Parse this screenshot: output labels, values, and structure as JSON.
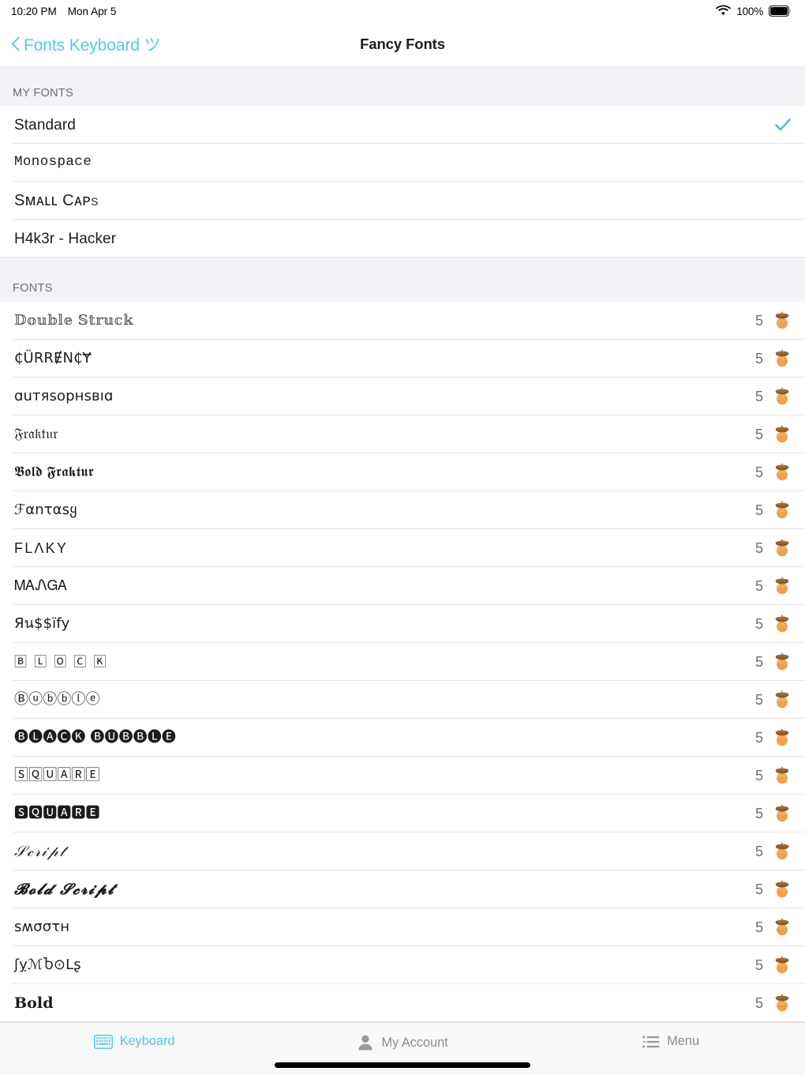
{
  "status_bar": {
    "time": "10:20 PM",
    "date": "Mon Apr 5",
    "battery_percent": "100%",
    "wifi_icon": "wifi-icon",
    "battery_icon": "battery-full-icon"
  },
  "nav": {
    "back_label": "Fonts Keyboard ツ",
    "back_icon": "chevron-left-icon",
    "title": "Fancy Fonts"
  },
  "colors": {
    "accent": "#52c7f2",
    "section_bg": "#f2f2f7",
    "row_bg": "#ffffff",
    "separator": "#e6e6e9",
    "secondary_text": "#6d6d72",
    "primary_text": "#1c1c1e"
  },
  "sections": [
    {
      "header": "MY FONTS",
      "rows": [
        {
          "label": "Standard",
          "style": "plain",
          "selected": true,
          "count": null,
          "locked": false
        },
        {
          "label": "Monospace",
          "style": "mono",
          "selected": false,
          "count": null,
          "locked": false
        },
        {
          "label": "Sᴍᴀʟʟ Cᴀᴘs",
          "style": "smallcaps",
          "selected": false,
          "count": null,
          "locked": false
        },
        {
          "label": "H4k3r - Hacker",
          "style": "plain",
          "selected": false,
          "count": null,
          "locked": false
        }
      ]
    },
    {
      "header": "FONTS",
      "rows": [
        {
          "label": "𝔻𝕠𝕦𝕓𝕝𝕖 𝕊𝕥𝕣𝕦𝕔𝕜",
          "style": "outline",
          "selected": false,
          "count": "5",
          "locked": true
        },
        {
          "label": "₵ÜRRɆN₵Ɏ",
          "style": "unicode",
          "selected": false,
          "count": "5",
          "locked": true
        },
        {
          "label": "ɑuтяѕорнѕвıɑ",
          "style": "unicode",
          "selected": false,
          "count": "5",
          "locked": true
        },
        {
          "label": "𝔉𝔯𝔞𝔨𝔱𝔲𝔯",
          "style": "fraktur",
          "selected": false,
          "count": "5",
          "locked": true
        },
        {
          "label": "𝕭𝖔𝖑𝖉 𝕱𝖗𝖆𝖐𝖙𝖚𝖗",
          "style": "fraktur-b",
          "selected": false,
          "count": "5",
          "locked": true
        },
        {
          "label": "ℱαnταsყ",
          "style": "unicode",
          "selected": false,
          "count": "5",
          "locked": true
        },
        {
          "label": "FLΛKY",
          "style": "wide",
          "selected": false,
          "count": "5",
          "locked": true
        },
        {
          "label": "ᎷᎪᏁᏀᎪ",
          "style": "unicode",
          "selected": false,
          "count": "5",
          "locked": true
        },
        {
          "label": "Яน$$ïfу",
          "style": "unicode",
          "selected": false,
          "count": "5",
          "locked": true
        },
        {
          "label": "🄱 🄻 🄾 🄲 🄺",
          "style": "boxed",
          "selected": false,
          "count": "5",
          "locked": true
        },
        {
          "label": "Ⓑⓤⓑⓑⓛⓔ",
          "style": "unicode",
          "selected": false,
          "count": "5",
          "locked": true
        },
        {
          "label": "🅑🅛🅐🅒🅚 🅑🅤🅑🅑🅛🅔",
          "style": "unicode",
          "selected": false,
          "count": "5",
          "locked": true
        },
        {
          "label": "🅂🅀🅄🄰🅁🄴",
          "style": "unicode",
          "selected": false,
          "count": "5",
          "locked": true
        },
        {
          "label": "🆂🆀🆄🅰🆁🅴",
          "style": "unicode",
          "selected": false,
          "count": "5",
          "locked": true
        },
        {
          "label": "𝒮𝒸𝓇𝒾𝓅𝓉",
          "style": "script",
          "selected": false,
          "count": "5",
          "locked": true
        },
        {
          "label": "𝓑𝓸𝓵𝓭 𝓢𝓬𝓻𝓲𝓹𝓽",
          "style": "script-b",
          "selected": false,
          "count": "5",
          "locked": true
        },
        {
          "label": "ꜱʍσστн",
          "style": "unicode",
          "selected": false,
          "count": "5",
          "locked": true
        },
        {
          "label": "ʃỵℳႦ⊙Ⅼʂ",
          "style": "unicode",
          "selected": false,
          "count": "5",
          "locked": true
        },
        {
          "label": "𝐁𝐨𝐥𝐝",
          "style": "bold",
          "selected": false,
          "count": "5",
          "locked": true
        }
      ]
    }
  ],
  "tab_bar": {
    "tabs": [
      {
        "label": "Keyboard",
        "icon": "keyboard-icon",
        "active": true
      },
      {
        "label": "My Account",
        "icon": "person-icon",
        "active": false
      },
      {
        "label": "Menu",
        "icon": "list-icon",
        "active": false
      }
    ]
  }
}
